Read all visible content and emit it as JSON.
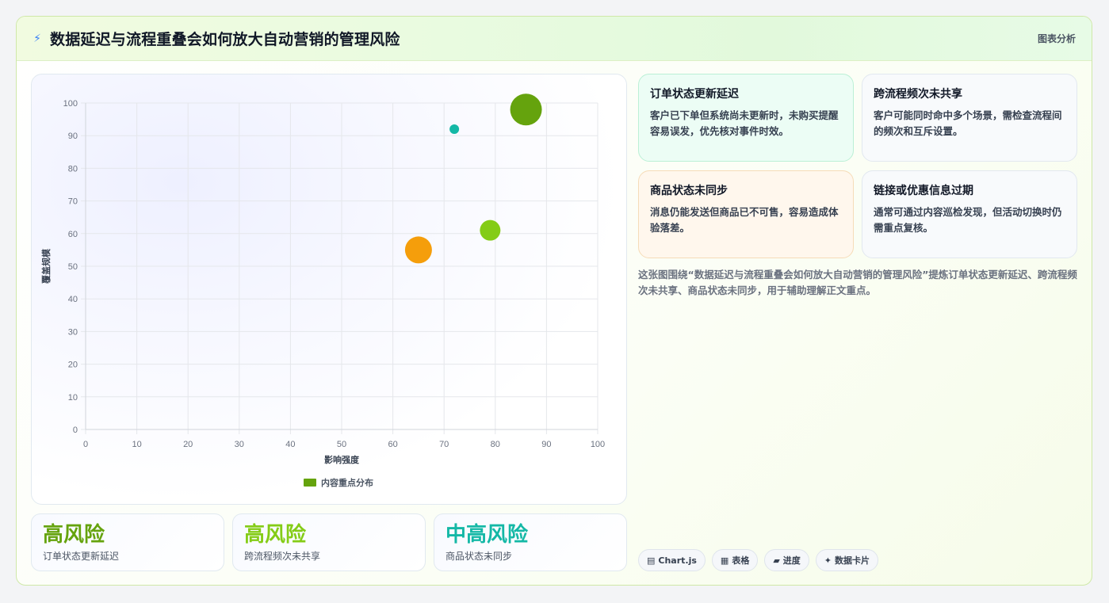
{
  "header": {
    "icon": "bolt-icon",
    "title": "数据延迟与流程重叠会如何放大自动营销的管理风险",
    "right_label": "图表分析"
  },
  "chart_data": {
    "type": "bubble",
    "xlabel": "影响强度",
    "ylabel": "覆盖规模",
    "xlim": [
      0,
      100
    ],
    "ylim": [
      0,
      100
    ],
    "xticks": [
      "0",
      "10",
      "20",
      "30",
      "40",
      "50",
      "60",
      "70",
      "80",
      "90",
      "100"
    ],
    "yticks": [
      "0",
      "10",
      "20",
      "30",
      "40",
      "50",
      "60",
      "70",
      "80",
      "90",
      "100"
    ],
    "grid": true,
    "legend": {
      "label": "内容重点分布",
      "position": "bottom",
      "color": "#65a30d"
    },
    "points": [
      {
        "x": 86,
        "y": 98,
        "r": 20,
        "color": "#65a30d"
      },
      {
        "x": 72,
        "y": 92,
        "r": 6,
        "color": "#14b8a6"
      },
      {
        "x": 79,
        "y": 61,
        "r": 13,
        "color": "#84cc16"
      },
      {
        "x": 65,
        "y": 55,
        "r": 17,
        "color": "#f59e0b"
      }
    ]
  },
  "stats": [
    {
      "value": "高风险",
      "label": "订单状态更新延迟",
      "color": "#65a30d"
    },
    {
      "value": "高风险",
      "label": "跨流程频次未共享",
      "color": "#84cc16"
    },
    {
      "value": "中高风险",
      "label": "商品状态未同步",
      "color": "#14b8a6"
    }
  ],
  "info_cards": [
    {
      "title": "订单状态更新延迟",
      "text": "客户已下单但系统尚未更新时，未购买提醒容易误发，优先核对事件时效。",
      "bg": "#ecfdf5",
      "border": "#bbf0d6"
    },
    {
      "title": "跨流程频次未共享",
      "text": "客户可能同时命中多个场景，需检查流程间的频次和互斥设置。",
      "bg": "#f8fafc",
      "border": "#e2e8f0"
    },
    {
      "title": "商品状态未同步",
      "text": "消息仍能发送但商品已不可售，容易造成体验落差。",
      "bg": "#fff7ed",
      "border": "#f6dcb8"
    },
    {
      "title": "链接或优惠信息过期",
      "text": "通常可通过内容巡检发现，但活动切换时仍需重点复核。",
      "bg": "#f8fafc",
      "border": "#e2e8f0"
    }
  ],
  "summary": "这张图围绕“数据延迟与流程重叠会如何放大自动营销的管理风险”提炼订单状态更新延迟、跨流程频次未共享、商品状态未同步，用于辅助理解正文重点。",
  "chips": [
    {
      "icon": "chart-icon",
      "glyph": "▤",
      "label": "Chart.js"
    },
    {
      "icon": "table-icon",
      "glyph": "▦",
      "label": "表格"
    },
    {
      "icon": "progress-icon",
      "glyph": "▰",
      "label": "进度"
    },
    {
      "icon": "sparkle-icon",
      "glyph": "✦",
      "label": "数据卡片"
    }
  ]
}
